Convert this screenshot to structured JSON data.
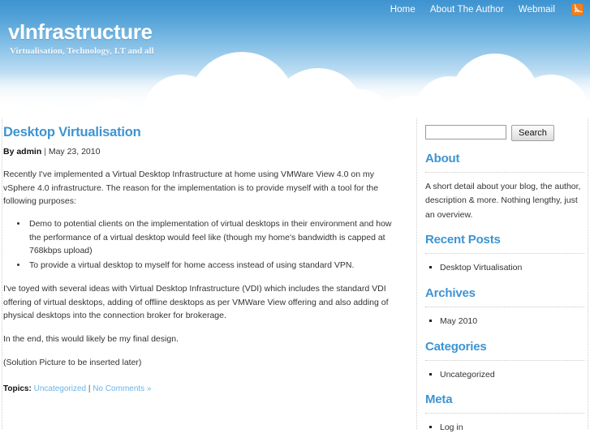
{
  "header": {
    "site_title": "vInfrastructure",
    "site_tagline": "Virtualisation, Technology, I.T and all",
    "nav": [
      {
        "label": "Home"
      },
      {
        "label": "About The Author"
      },
      {
        "label": "Webmail"
      }
    ],
    "rss_icon": "rss-feed-icon"
  },
  "post": {
    "title": "Desktop Virtualisation",
    "author_prefix": "By admin",
    "meta_separator": " | ",
    "date": "May 23, 2010",
    "paragraph_1": "Recently I've implemented a Virtual Desktop Infrastructure at home using VMWare View 4.0 on my vSphere 4.0 infrastructure. The reason for the implementation is to provide myself with a tool for the following purposes:",
    "bullets": [
      "Demo to potential clients on the implementation of virtual desktops in their environment and how the performance of a virtual desktop would feel like (though my home's bandwidth is capped at 768kbps upload)",
      "To provide a virtual desktop to myself for home access instead of using standard VPN."
    ],
    "paragraph_2": "I've toyed with several ideas with Virtual Desktop Infrastructure (VDI) which includes the standard VDI offering of virtual desktops, adding of offline desktops as per VMWare View offering and also adding of physical desktops into the connection broker for brokerage.",
    "paragraph_3": "In the end, this would likely be my final design.",
    "paragraph_4": "(Solution Picture to be inserted later)",
    "topics_label": "Topics:",
    "topic_link": "Uncategorized",
    "topics_sep": "|",
    "comments_link": "No Comments »"
  },
  "sidebar": {
    "search": {
      "value": "",
      "placeholder": "",
      "button_label": "Search"
    },
    "about": {
      "title": "About",
      "text": "A short detail about your blog, the author, description & more. Nothing lengthy, just an overview."
    },
    "recent_posts": {
      "title": "Recent Posts",
      "items": [
        {
          "label": "Desktop Virtualisation"
        }
      ]
    },
    "archives": {
      "title": "Archives",
      "items": [
        {
          "label": "May 2010"
        }
      ]
    },
    "categories": {
      "title": "Categories",
      "items": [
        {
          "label": "Uncategorized"
        }
      ]
    },
    "meta": {
      "title": "Meta",
      "items": [
        {
          "label": "Log in"
        }
      ]
    }
  },
  "colors": {
    "accent_blue": "#3d94d2",
    "header_blue": "#3d93d0",
    "link_blue": "#6cb4e4",
    "rss_orange": "#f08020",
    "body_text": "#333333"
  }
}
